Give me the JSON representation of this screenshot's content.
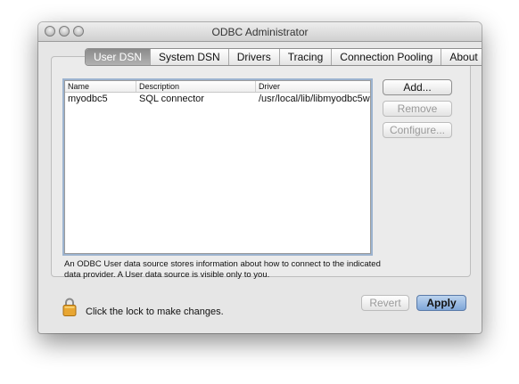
{
  "window": {
    "title": "ODBC Administrator"
  },
  "tabs": [
    {
      "label": "User DSN",
      "active": true
    },
    {
      "label": "System DSN",
      "active": false
    },
    {
      "label": "Drivers",
      "active": false
    },
    {
      "label": "Tracing",
      "active": false
    },
    {
      "label": "Connection Pooling",
      "active": false
    },
    {
      "label": "About",
      "active": false
    }
  ],
  "list": {
    "headers": [
      "Name",
      "Description",
      "Driver"
    ],
    "rows": [
      [
        "myodbc5",
        "SQL connector",
        "/usr/local/lib/libmyodbc5w"
      ]
    ]
  },
  "buttons": {
    "add": "Add...",
    "remove": "Remove",
    "configure": "Configure...",
    "revert": "Revert",
    "apply": "Apply"
  },
  "description": "An ODBC User data source stores information about how to connect to the indicated data provider. A User data source is visible only to you.",
  "lock_text": "Click the lock to make changes.",
  "icons": [
    "lock-icon"
  ]
}
